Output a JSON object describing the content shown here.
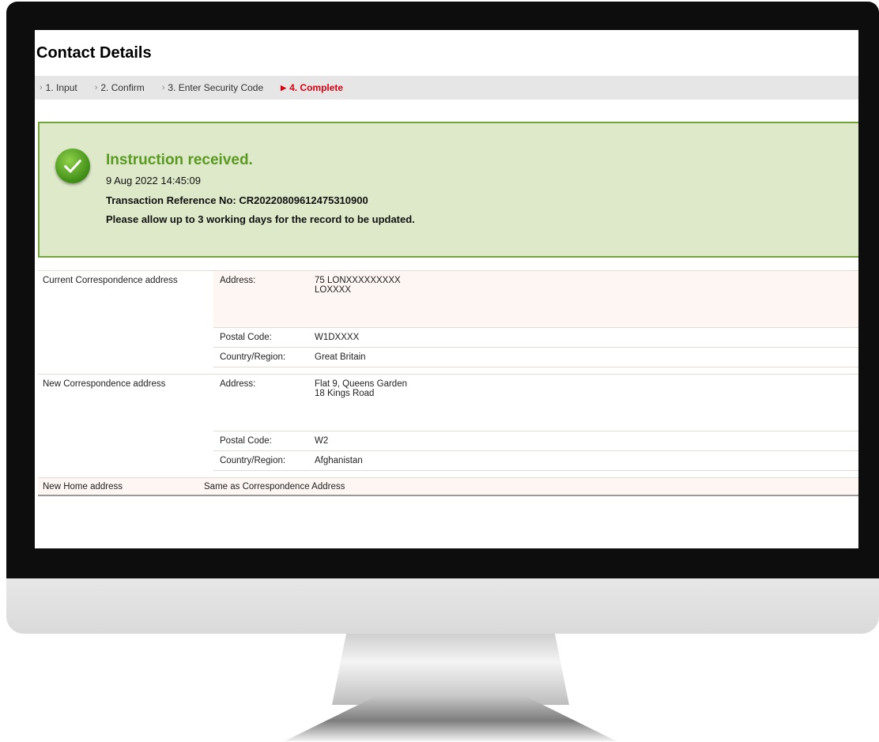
{
  "page": {
    "title": "Contact Details"
  },
  "steps": [
    {
      "label": "1. Input",
      "active": false
    },
    {
      "label": "2. Confirm",
      "active": false
    },
    {
      "label": "3. Enter Security Code",
      "active": false
    },
    {
      "label": "4. Complete",
      "active": true
    }
  ],
  "confirmation": {
    "icon": "check-circle-icon",
    "title": "Instruction received.",
    "timestamp": "9 Aug 2022 14:45:09",
    "reference": "Transaction Reference No: CR20220809612475310900",
    "note": "Please allow up to 3 working days for the record to be updated."
  },
  "current_address": {
    "label": "Current Correspondence address",
    "address_key": "Address:",
    "address_value": "75 LONXXXXXXXXX\nLOXXXX",
    "postal_key": "Postal Code:",
    "postal_value": "W1DXXXX",
    "country_key": "Country/Region:",
    "country_value": "Great Britain"
  },
  "new_address": {
    "label": "New Correspondence address",
    "address_key": "Address:",
    "address_value": "Flat 9, Queens Garden\n18 Kings Road",
    "postal_key": "Postal Code:",
    "postal_value": "W2",
    "country_key": "Country/Region:",
    "country_value": "Afghanistan"
  },
  "home_address": {
    "label": "New Home address",
    "value": "Same as Correspondence Address"
  },
  "colors": {
    "accent_red": "#db0011",
    "success_green": "#5a9a22",
    "success_bg": "#dde9c8"
  }
}
